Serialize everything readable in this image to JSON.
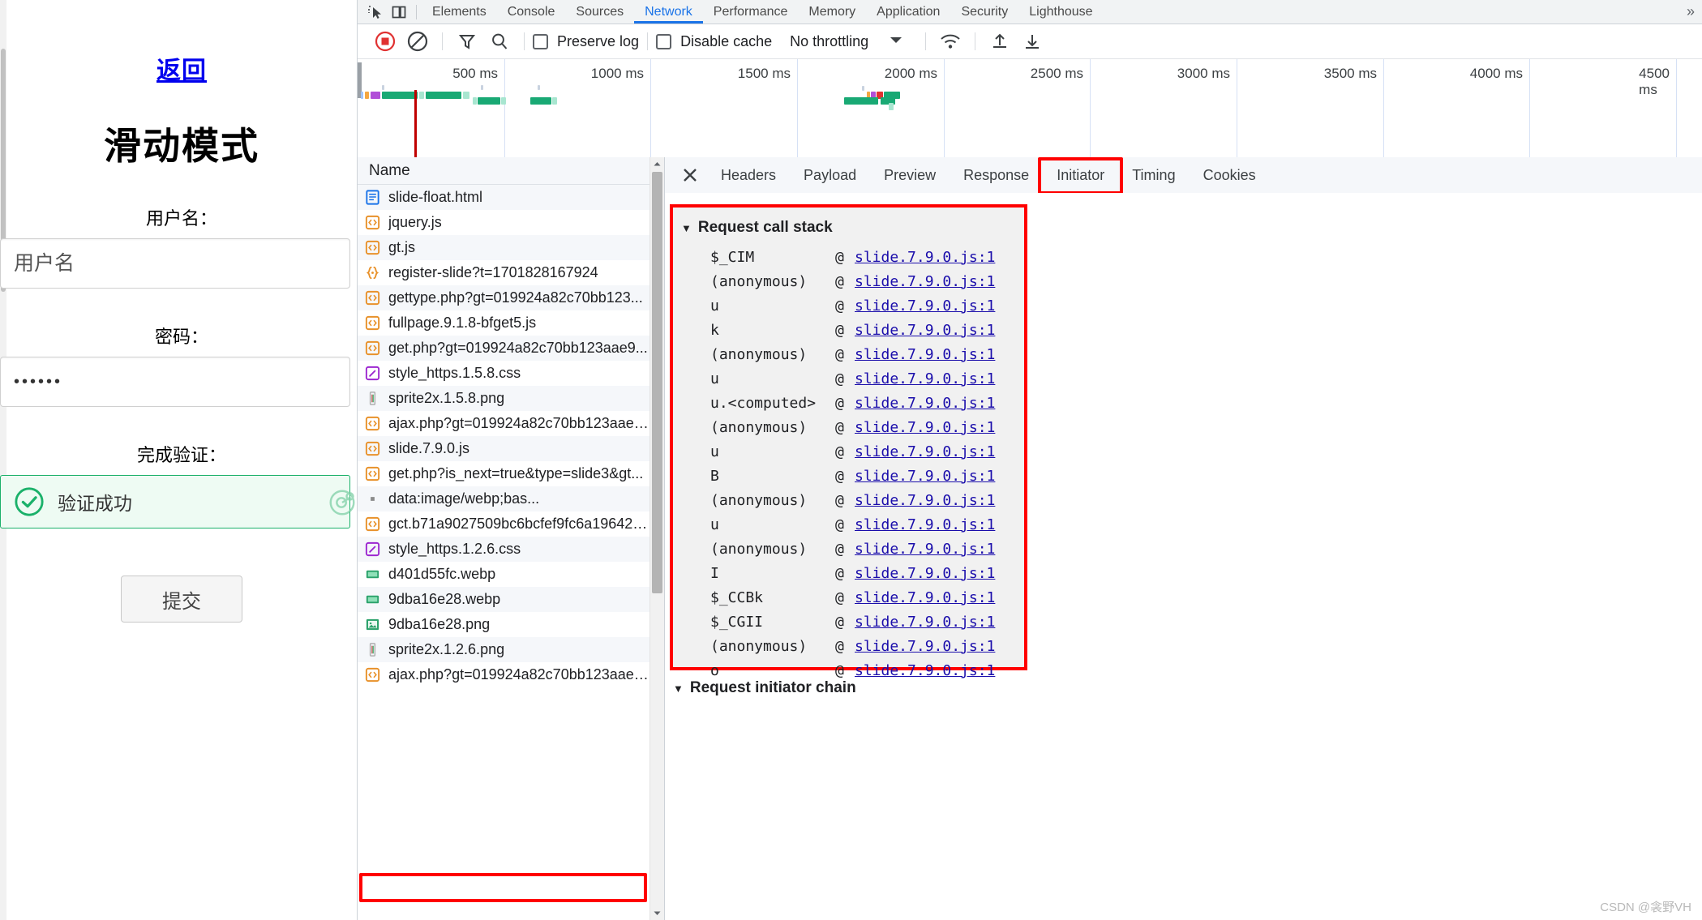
{
  "page": {
    "back_link": "返回",
    "title": "滑动模式",
    "username_label": "用户名：",
    "username_value": "用户名",
    "password_label": "密码：",
    "password_value": "••••••",
    "captcha_label": "完成验证：",
    "captcha_status": "验证成功",
    "submit_label": "提交",
    "accent_success": "#1bb16a",
    "link_color": "#0000ee"
  },
  "devtools": {
    "tabs": [
      {
        "label": "Elements",
        "active": false
      },
      {
        "label": "Console",
        "active": false
      },
      {
        "label": "Sources",
        "active": false
      },
      {
        "label": "Network",
        "active": true
      },
      {
        "label": "Performance",
        "active": false
      },
      {
        "label": "Memory",
        "active": false
      },
      {
        "label": "Application",
        "active": false
      },
      {
        "label": "Security",
        "active": false
      },
      {
        "label": "Lighthouse",
        "active": false
      }
    ],
    "more_tabs_icon": "chevron-double-right-icon",
    "inspect_icon": "inspect-element-icon",
    "device_icon": "toggle-device-toolbar-icon",
    "toolbar": {
      "record_icon": "record-stop-icon",
      "clear_icon": "clear-network-log-icon",
      "filter_icon": "filter-icon",
      "search_icon": "search-icon",
      "preserve_log": "Preserve log",
      "preserve_log_checked": false,
      "disable_cache": "Disable cache",
      "disable_cache_checked": false,
      "throttling": "No throttling",
      "throttle_caret_icon": "chevron-down-icon",
      "wifi_icon": "network-conditions-icon",
      "import_icon": "import-har-icon",
      "export_icon": "export-har-icon"
    },
    "overview": {
      "ticks": [
        "500 ms",
        "1000 ms",
        "1500 ms",
        "2000 ms",
        "2500 ms",
        "3000 ms",
        "3500 ms",
        "4000 ms",
        "4500 ms"
      ],
      "red_marker_ms": 470
    },
    "requests": {
      "column_header": "Name",
      "rows": [
        {
          "name": "slide-float.html",
          "icon": "document-icon"
        },
        {
          "name": "jquery.js",
          "icon": "script-icon"
        },
        {
          "name": "gt.js",
          "icon": "script-icon"
        },
        {
          "name": "register-slide?t=1701828167924",
          "icon": "json-icon"
        },
        {
          "name": "gettype.php?gt=019924a82c70bb123...",
          "icon": "script-icon"
        },
        {
          "name": "fullpage.9.1.8-bfget5.js",
          "icon": "script-icon"
        },
        {
          "name": "get.php?gt=019924a82c70bb123aae9...",
          "icon": "script-icon"
        },
        {
          "name": "style_https.1.5.8.css",
          "icon": "stylesheet-icon"
        },
        {
          "name": "sprite2x.1.5.8.png",
          "icon": "image-icon"
        },
        {
          "name": "ajax.php?gt=019924a82c70bb123aae9...",
          "icon": "script-icon"
        },
        {
          "name": "slide.7.9.0.js",
          "icon": "script-icon"
        },
        {
          "name": "get.php?is_next=true&type=slide3&gt...",
          "icon": "script-icon"
        },
        {
          "name": "data:image/webp;bas...",
          "icon": "generic-icon"
        },
        {
          "name": "gct.b71a9027509bc6bcfef9fc6a196424...",
          "icon": "script-icon"
        },
        {
          "name": "style_https.1.2.6.css",
          "icon": "stylesheet-icon"
        },
        {
          "name": "d401d55fc.webp",
          "icon": "webp-icon"
        },
        {
          "name": "9dba16e28.webp",
          "icon": "webp-icon"
        },
        {
          "name": "9dba16e28.png",
          "icon": "png-icon"
        },
        {
          "name": "sprite2x.1.2.6.png",
          "icon": "image-icon"
        },
        {
          "name": "ajax.php?gt=019924a82c70bb123aae9...",
          "icon": "script-icon",
          "highlighted": true
        }
      ]
    },
    "detail": {
      "close_icon": "close-icon",
      "tabs": [
        {
          "label": "Headers",
          "active": false
        },
        {
          "label": "Payload",
          "active": false
        },
        {
          "label": "Preview",
          "active": false
        },
        {
          "label": "Response",
          "active": false
        },
        {
          "label": "Initiator",
          "active": true
        },
        {
          "label": "Timing",
          "active": false
        },
        {
          "label": "Cookies",
          "active": false
        }
      ],
      "call_stack_title": "Request call stack",
      "call_stack": [
        {
          "fn": "$_CIM",
          "at": "@",
          "src": "slide.7.9.0.js:1"
        },
        {
          "fn": "(anonymous)",
          "at": "@",
          "src": "slide.7.9.0.js:1"
        },
        {
          "fn": "u",
          "at": "@",
          "src": "slide.7.9.0.js:1"
        },
        {
          "fn": "k",
          "at": "@",
          "src": "slide.7.9.0.js:1"
        },
        {
          "fn": "(anonymous)",
          "at": "@",
          "src": "slide.7.9.0.js:1"
        },
        {
          "fn": "u",
          "at": "@",
          "src": "slide.7.9.0.js:1"
        },
        {
          "fn": "u.<computed>",
          "at": "@",
          "src": "slide.7.9.0.js:1"
        },
        {
          "fn": "(anonymous)",
          "at": "@",
          "src": "slide.7.9.0.js:1"
        },
        {
          "fn": "u",
          "at": "@",
          "src": "slide.7.9.0.js:1"
        },
        {
          "fn": "B",
          "at": "@",
          "src": "slide.7.9.0.js:1"
        },
        {
          "fn": "(anonymous)",
          "at": "@",
          "src": "slide.7.9.0.js:1"
        },
        {
          "fn": "u",
          "at": "@",
          "src": "slide.7.9.0.js:1"
        },
        {
          "fn": "(anonymous)",
          "at": "@",
          "src": "slide.7.9.0.js:1"
        },
        {
          "fn": "I",
          "at": "@",
          "src": "slide.7.9.0.js:1"
        },
        {
          "fn": "$_CCBk",
          "at": "@",
          "src": "slide.7.9.0.js:1"
        },
        {
          "fn": "$_CGII",
          "at": "@",
          "src": "slide.7.9.0.js:1"
        },
        {
          "fn": "(anonymous)",
          "at": "@",
          "src": "slide.7.9.0.js:1"
        },
        {
          "fn": "o",
          "at": "@",
          "src": "slide.7.9.0.js:1"
        }
      ],
      "initiator_chain_title": "Request initiator chain",
      "chain_caret_icon": "triangle-down-icon"
    },
    "highlight_color": "#ff0000"
  },
  "watermark": "CSDN @衾野VH"
}
